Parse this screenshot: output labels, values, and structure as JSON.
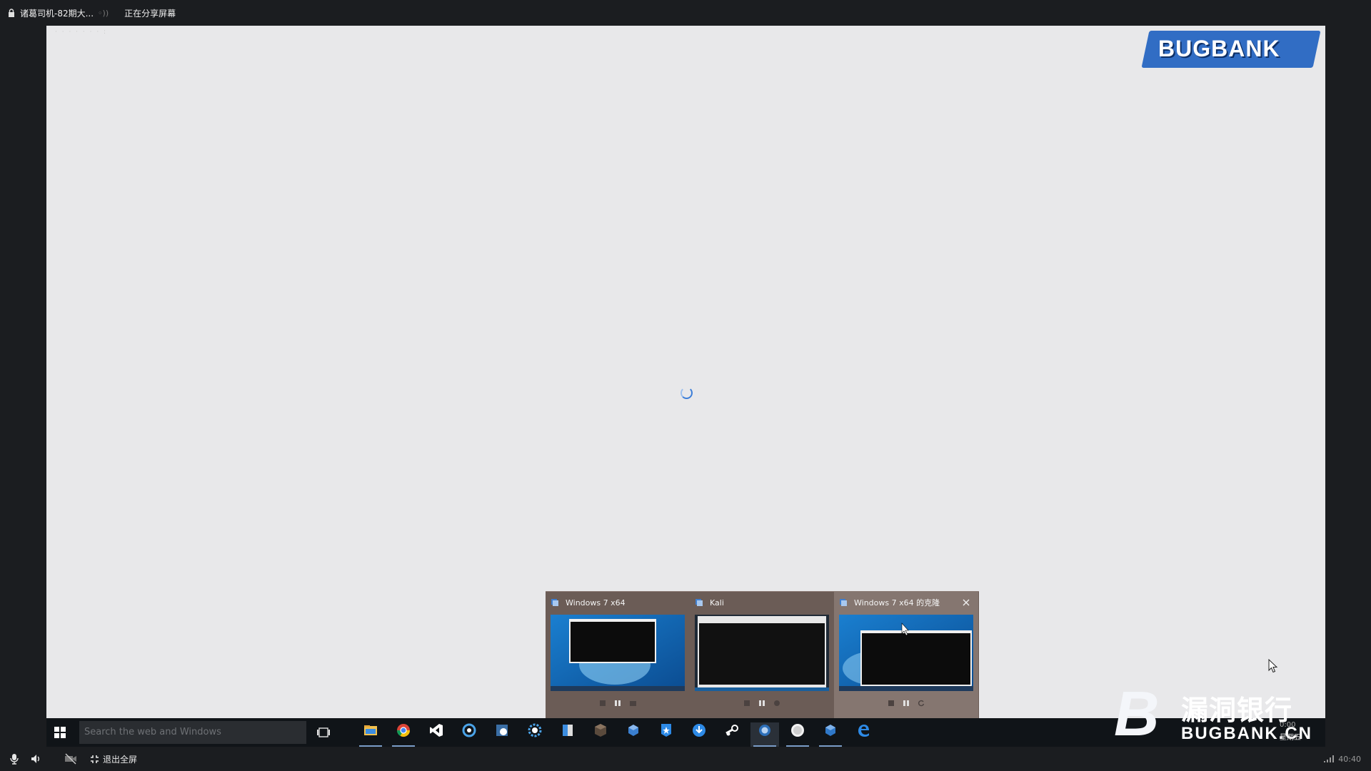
{
  "top_bar": {
    "meeting_title": "诸葛司机-82期大...",
    "status": "正在分享屏幕"
  },
  "screen": {
    "corner_text": "· · ·   · ·  ·   ·  :"
  },
  "watermark_top": {
    "text": "BUGBANK"
  },
  "thumbnails": [
    {
      "title": "Windows 7 x64",
      "active": false,
      "close": false
    },
    {
      "title": "Kali",
      "active": false,
      "close": false
    },
    {
      "title": "Windows 7 x64 的克隆",
      "active": true,
      "close": true
    }
  ],
  "taskbar": {
    "search_placeholder": "Search the web and Windows",
    "apps": [
      {
        "name": "file-explorer-icon",
        "running": true
      },
      {
        "name": "chrome-icon",
        "running": true
      },
      {
        "name": "visual-studio-icon",
        "running": false
      },
      {
        "name": "app-blue-ring-icon",
        "running": false
      },
      {
        "name": "network-app-icon",
        "running": false
      },
      {
        "name": "settings-gear-icon",
        "running": false
      },
      {
        "name": "app-window-icon",
        "running": false
      },
      {
        "name": "package-icon",
        "running": false
      },
      {
        "name": "cube-icon",
        "running": false
      },
      {
        "name": "star-icon",
        "running": false
      },
      {
        "name": "download-icon",
        "running": false
      },
      {
        "name": "steam-icon",
        "running": false
      },
      {
        "name": "vmware-icon",
        "running": true,
        "current": true
      },
      {
        "name": "circle-app-icon",
        "running": true
      },
      {
        "name": "cube2-icon",
        "running": true
      },
      {
        "name": "edge-icon",
        "running": false
      }
    ]
  },
  "watermark_bottom": {
    "cn": "漏洞银行",
    "en": "BUGBANK.CN"
  },
  "clock": {
    "time": "0:00",
    "day": "星期五"
  },
  "control_bar": {
    "exit_fullscreen": "退出全屏",
    "elapsed": "40:40"
  }
}
